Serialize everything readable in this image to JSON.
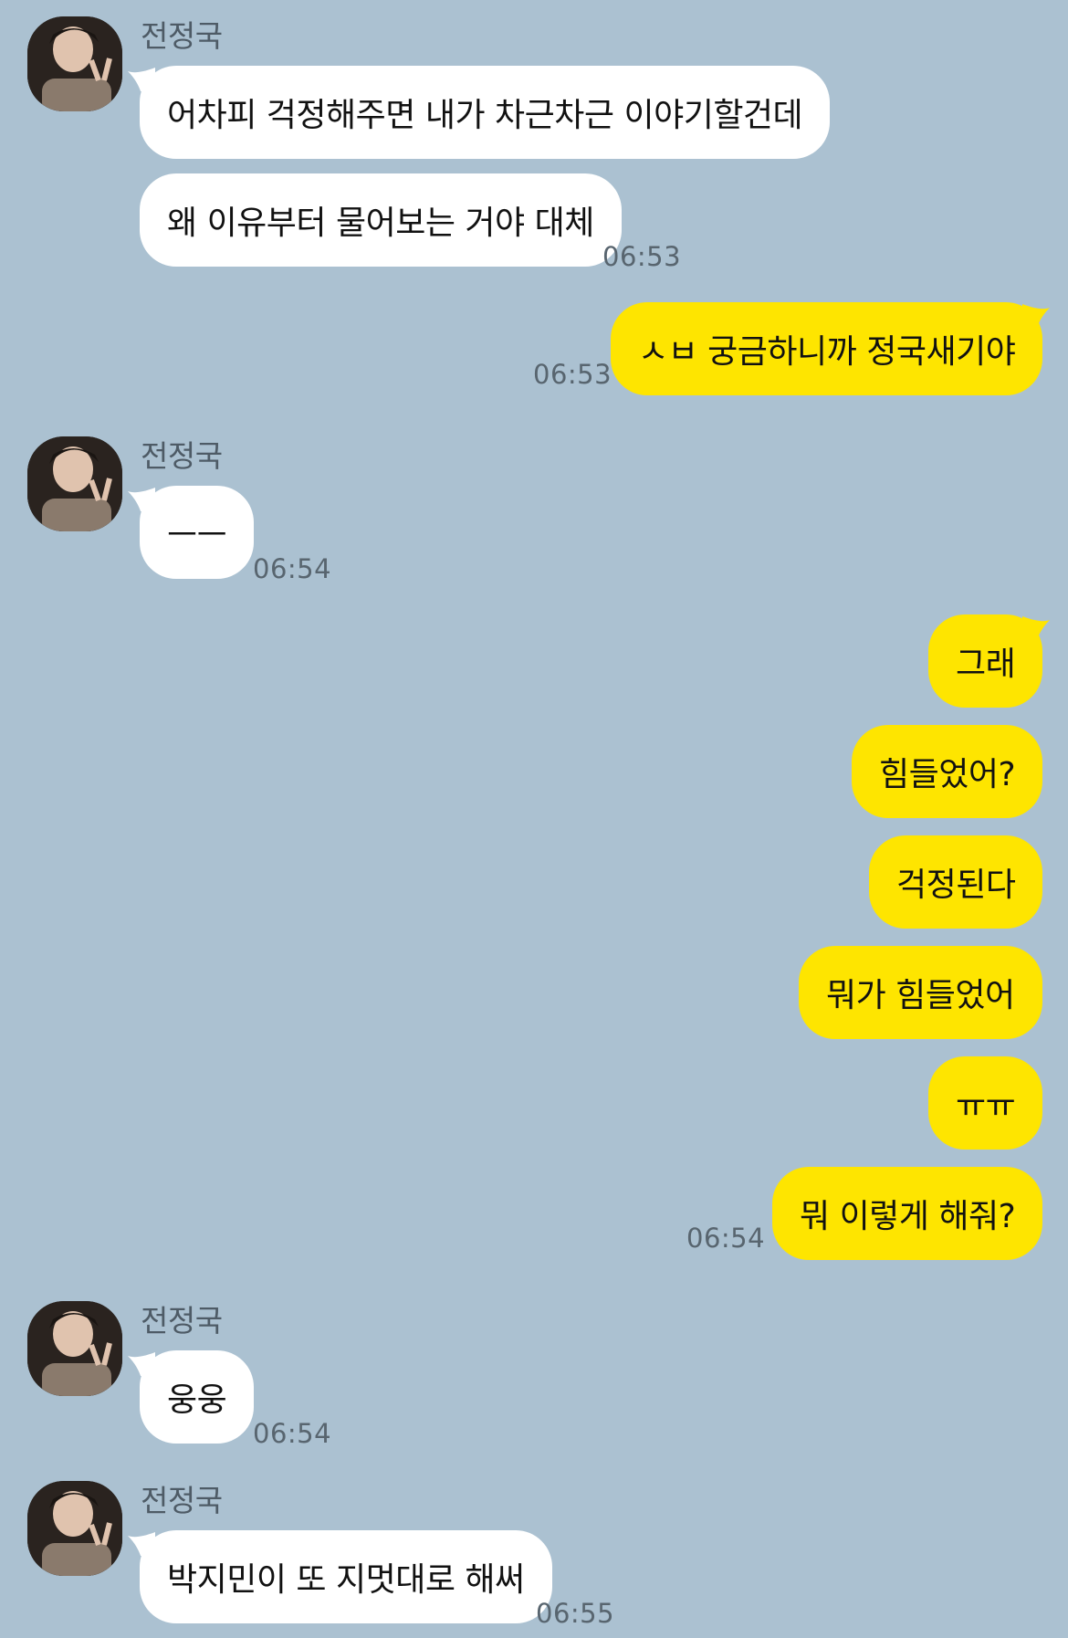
{
  "chat": {
    "sender": "전정국",
    "colors": {
      "background": "#abc1d1",
      "incoming": "#ffffff",
      "outgoing": "#fee500",
      "timestamp": "#58656f"
    },
    "messages": [
      {
        "text": "어차피 걱정해주면 내가 차근차근 이야기할건데"
      },
      {
        "text": "왜 이유부터 물어보는 거야 대체",
        "time": "06:53"
      },
      {
        "text": "ㅅㅂ 궁금하니까 정국새기야",
        "time": "06:53"
      },
      {
        "text": "ㅡㅡ",
        "time": "06:54"
      },
      {
        "text": "그래"
      },
      {
        "text": "힘들었어?"
      },
      {
        "text": "걱정된다"
      },
      {
        "text": "뭐가 힘들었어"
      },
      {
        "text": "ㅠㅠ"
      },
      {
        "text": "뭐 이렇게 해줘?",
        "time": "06:54"
      },
      {
        "text": "웅웅",
        "time": "06:54"
      },
      {
        "text": "박지민이 또 지멋대로 해써",
        "time": "06:55"
      }
    ]
  }
}
